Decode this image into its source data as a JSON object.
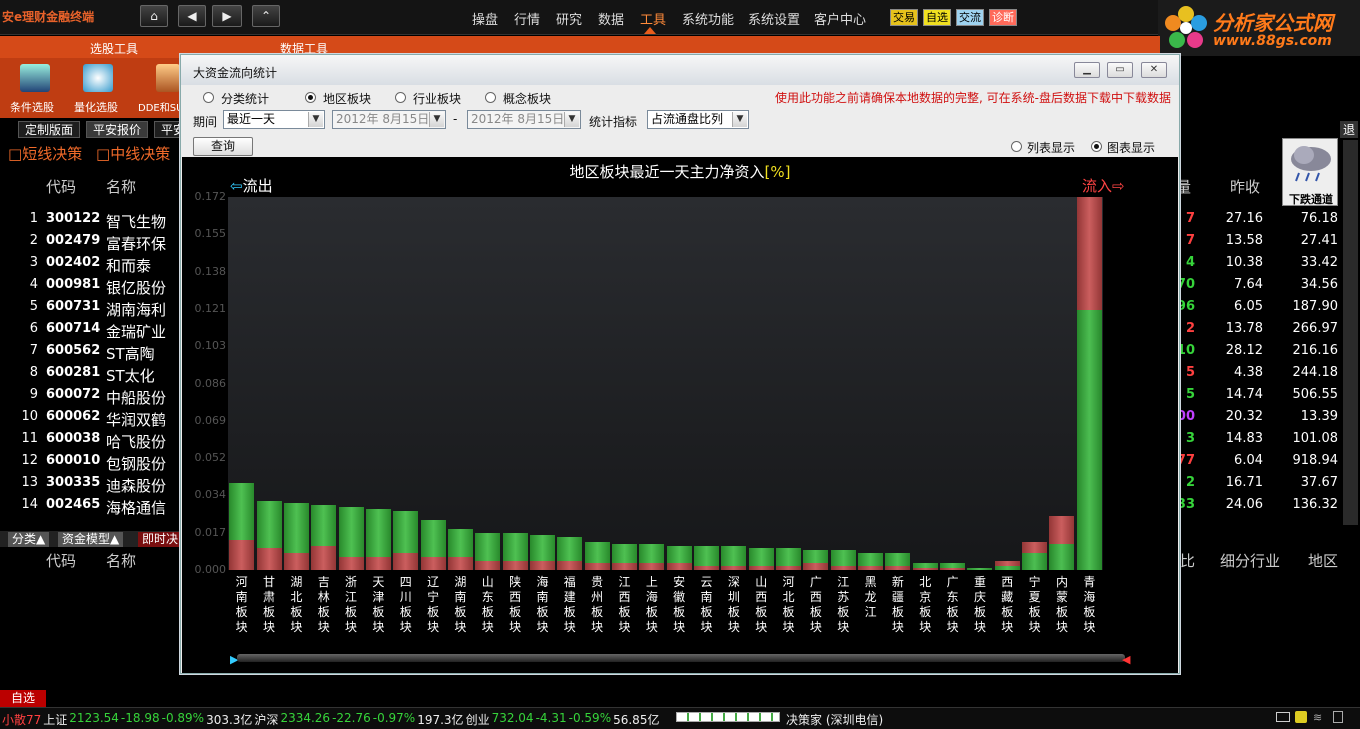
{
  "app": {
    "title": "安e理财金融终端",
    "brand": "分析家公式网",
    "brand_url": "www.88gs.com"
  },
  "topnav": {
    "buttons": [
      "⌂",
      "◀",
      "▶",
      "⌃"
    ],
    "menu": [
      "操盘",
      "行情",
      "研究",
      "数据",
      "工具",
      "系统功能",
      "系统设置",
      "客户中心"
    ],
    "active": "工具",
    "quick": [
      "交易",
      "自选",
      "交流",
      "诊断"
    ]
  },
  "subnav": {
    "tabs": [
      "选股工具",
      "数据工具"
    ]
  },
  "toolbar": {
    "items": [
      "条件选股",
      "量化选股",
      "DDE和SU"
    ]
  },
  "tabs2": [
    "定制版面",
    "平安报价",
    "平安"
  ],
  "filters": [
    "短线决策",
    "中线决策"
  ],
  "quote": {
    "headers": {
      "code": "代码",
      "name": "名称",
      "vol": "量",
      "prev": "昨收"
    },
    "rows": [
      {
        "n": "1",
        "code": "300122",
        "name": "智飞生物",
        "v": "7",
        "vc": "#ff4040",
        "p": "27.16",
        "q": "76.18"
      },
      {
        "n": "2",
        "code": "002479",
        "name": "富春环保",
        "v": "7",
        "vc": "#ff4040",
        "p": "13.58",
        "q": "27.41"
      },
      {
        "n": "3",
        "code": "002402",
        "name": "和而泰",
        "v": "4",
        "vc": "#36d43a",
        "p": "10.38",
        "q": "33.42"
      },
      {
        "n": "4",
        "code": "000981",
        "name": "银亿股份",
        "v": "70",
        "vc": "#36d43a",
        "p": "7.64",
        "q": "34.56"
      },
      {
        "n": "5",
        "code": "600731",
        "name": "湖南海利",
        "v": "96",
        "vc": "#36d43a",
        "p": "6.05",
        "q": "187.90"
      },
      {
        "n": "6",
        "code": "600714",
        "name": "金瑞矿业",
        "v": "2",
        "vc": "#ff4040",
        "p": "13.78",
        "q": "266.97"
      },
      {
        "n": "7",
        "code": "600562",
        "name": "ST高陶",
        "v": "10",
        "vc": "#36d43a",
        "p": "28.12",
        "q": "216.16"
      },
      {
        "n": "8",
        "code": "600281",
        "name": "ST太化",
        "v": "5",
        "vc": "#ff4040",
        "p": "4.38",
        "q": "244.18"
      },
      {
        "n": "9",
        "code": "600072",
        "name": "中船股份",
        "v": "5",
        "vc": "#36d43a",
        "p": "14.74",
        "q": "506.55"
      },
      {
        "n": "10",
        "code": "600062",
        "name": "华润双鹤",
        "v": "00",
        "vc": "#c040ff",
        "p": "20.32",
        "q": "13.39"
      },
      {
        "n": "11",
        "code": "600038",
        "name": "哈飞股份",
        "v": "3",
        "vc": "#36d43a",
        "p": "14.83",
        "q": "101.08"
      },
      {
        "n": "12",
        "code": "600010",
        "name": "包钢股份",
        "v": "77",
        "vc": "#ff4040",
        "p": "6.04",
        "q": "918.94"
      },
      {
        "n": "13",
        "code": "300335",
        "name": "迪森股份",
        "v": "2",
        "vc": "#36d43a",
        "p": "16.71",
        "q": "37.67"
      },
      {
        "n": "14",
        "code": "002465",
        "name": "海格通信",
        "v": "33",
        "vc": "#36d43a",
        "p": "24.06",
        "q": "136.32"
      }
    ]
  },
  "weather": "下跌通道",
  "bottom": {
    "tabs": [
      "分类▲",
      "资金模型▲",
      "即时决"
    ],
    "headers": [
      "代码",
      "名称",
      "比",
      "细分行业",
      "地区"
    ],
    "zixuan": "自选"
  },
  "status": {
    "items": [
      {
        "t": "小散77",
        "c": "#ff4040"
      },
      {
        "t": "上证",
        "c": "#eee"
      },
      {
        "t": "2123.54",
        "c": "#36d43a"
      },
      {
        "t": "-18.98",
        "c": "#36d43a"
      },
      {
        "t": "-0.89%",
        "c": "#36d43a"
      },
      {
        "t": "303.3亿",
        "c": "#eee"
      },
      {
        "t": "沪深",
        "c": "#eee"
      },
      {
        "t": "2334.26",
        "c": "#36d43a"
      },
      {
        "t": "-22.76",
        "c": "#36d43a"
      },
      {
        "t": "-0.97%",
        "c": "#36d43a"
      },
      {
        "t": "197.3亿",
        "c": "#eee"
      },
      {
        "t": "创业",
        "c": "#eee"
      },
      {
        "t": "732.04",
        "c": "#36d43a"
      },
      {
        "t": "-4.31",
        "c": "#36d43a"
      },
      {
        "t": "-0.59%",
        "c": "#36d43a"
      },
      {
        "t": "56.85亿",
        "c": "#eee"
      }
    ],
    "provider": "决策家 (深圳电信)"
  },
  "dialog": {
    "title": "大资金流向统计",
    "radios": [
      "分类统计",
      "地区板块",
      "行业板块",
      "概念板块"
    ],
    "radio_selected": "地区板块",
    "warning": "使用此功能之前请确保本地数据的完整, 可在系统-盘后数据下载中下载数据",
    "period_label": "期间",
    "period_value": "最近一天",
    "date_from": "2012年 8月15日",
    "date_sep": "-",
    "date_to": "2012年 8月15日",
    "stat_label": "统计指标",
    "stat_value": "占流通盘比列",
    "query": "查询",
    "view_list": "列表显示",
    "view_chart": "图表显示",
    "view_selected": "图表显示"
  },
  "chart_data": {
    "type": "bar",
    "title": "地区板块最近一天主力净资入",
    "title_unit": "[%]",
    "left_label": "流出",
    "right_label": "流入",
    "yticks": [
      "0.172",
      "0.155",
      "0.138",
      "0.121",
      "0.103",
      "0.086",
      "0.069",
      "0.052",
      "0.034",
      "0.017",
      "0.000"
    ],
    "ylim": [
      0,
      0.172
    ],
    "categories": [
      "河南板块",
      "甘肃板块",
      "湖北板块",
      "吉林板块",
      "浙江板块",
      "天津板块",
      "四川板块",
      "辽宁板块",
      "湖南板块",
      "山东板块",
      "陕西板块",
      "海南板块",
      "福建板块",
      "贵州板块",
      "江西板块",
      "上海板块",
      "安徽板块",
      "云南板块",
      "深圳板块",
      "山西板块",
      "河北板块",
      "广西板块",
      "江苏板块",
      "黑龙江",
      "新疆板块",
      "北京板块",
      "广东板块",
      "重庆板块",
      "西藏板块",
      "宁夏板块",
      "内蒙板块",
      "青海板块"
    ],
    "direction": [
      "out",
      "out",
      "out",
      "out",
      "out",
      "out",
      "out",
      "out",
      "out",
      "out",
      "out",
      "out",
      "out",
      "out",
      "out",
      "out",
      "out",
      "out",
      "out",
      "out",
      "out",
      "out",
      "out",
      "out",
      "out",
      "out",
      "out",
      "in",
      "in",
      "in",
      "in",
      "in"
    ],
    "values": [
      0.04,
      0.032,
      0.031,
      0.03,
      0.029,
      0.028,
      0.027,
      0.023,
      0.019,
      0.017,
      0.017,
      0.016,
      0.015,
      0.013,
      0.012,
      0.012,
      0.011,
      0.011,
      0.011,
      0.01,
      0.01,
      0.009,
      0.009,
      0.008,
      0.008,
      0.003,
      0.003,
      0.001,
      0.004,
      0.013,
      0.025,
      0.172
    ],
    "inner": [
      0.014,
      0.01,
      0.008,
      0.011,
      0.006,
      0.006,
      0.008,
      0.006,
      0.006,
      0.004,
      0.004,
      0.004,
      0.004,
      0.003,
      0.003,
      0.003,
      0.003,
      0.002,
      0.002,
      0.002,
      0.002,
      0.003,
      0.002,
      0.002,
      0.002,
      0.001,
      0.001,
      0.001,
      0.002,
      0.008,
      0.012,
      0.12
    ]
  }
}
